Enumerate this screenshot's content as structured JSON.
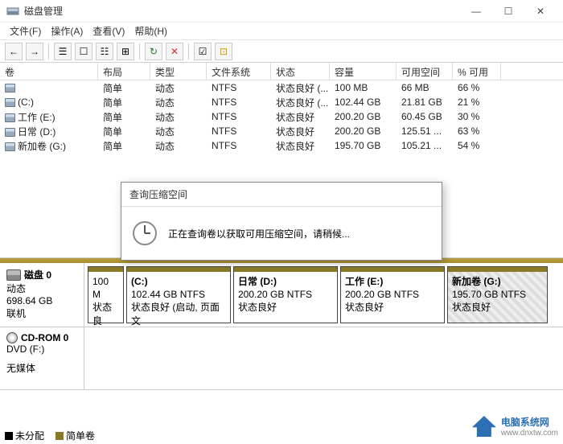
{
  "window": {
    "title": "磁盘管理",
    "min": "—",
    "max": "☐",
    "close": "✕"
  },
  "menu": {
    "file": "文件(F)",
    "action": "操作(A)",
    "view": "查看(V)",
    "help": "帮助(H)"
  },
  "columns": {
    "volume": "卷",
    "layout": "布局",
    "type": "类型",
    "fs": "文件系统",
    "status": "状态",
    "capacity": "容量",
    "free": "可用空间",
    "pct": "% 可用"
  },
  "volumes": [
    {
      "name": "",
      "layout": "简单",
      "type": "动态",
      "fs": "NTFS",
      "status": "状态良好 (...",
      "cap": "100 MB",
      "free": "66 MB",
      "pct": "66 %"
    },
    {
      "name": "(C:)",
      "layout": "简单",
      "type": "动态",
      "fs": "NTFS",
      "status": "状态良好 (...",
      "cap": "102.44 GB",
      "free": "21.81 GB",
      "pct": "21 %"
    },
    {
      "name": "工作 (E:)",
      "layout": "简单",
      "type": "动态",
      "fs": "NTFS",
      "status": "状态良好",
      "cap": "200.20 GB",
      "free": "60.45 GB",
      "pct": "30 %"
    },
    {
      "name": "日常 (D:)",
      "layout": "简单",
      "type": "动态",
      "fs": "NTFS",
      "status": "状态良好",
      "cap": "200.20 GB",
      "free": "125.51 ...",
      "pct": "63 %"
    },
    {
      "name": "新加卷 (G:)",
      "layout": "简单",
      "type": "动态",
      "fs": "NTFS",
      "status": "状态良好",
      "cap": "195.70 GB",
      "free": "105.21 ...",
      "pct": "54 %"
    }
  ],
  "disk0": {
    "label": "磁盘 0",
    "type": "动态",
    "size": "698.64 GB",
    "state": "联机",
    "p0": {
      "size": "100 M",
      "status": "状态良"
    },
    "p1": {
      "label": "(C:)",
      "size": "102.44 GB NTFS",
      "status": "状态良好 (启动, 页面文"
    },
    "p2": {
      "label": "日常  (D:)",
      "size": "200.20 GB NTFS",
      "status": "状态良好"
    },
    "p3": {
      "label": "工作  (E:)",
      "size": "200.20 GB NTFS",
      "status": "状态良好"
    },
    "p4": {
      "label": "新加卷  (G:)",
      "size": "195.70 GB NTFS",
      "status": "状态良好"
    }
  },
  "cdrom": {
    "label": "CD-ROM 0",
    "sub": "DVD (F:)",
    "nomedia": "无媒体"
  },
  "legend": {
    "unalloc": "未分配",
    "simple": "简单卷"
  },
  "dialog": {
    "title": "查询压缩空间",
    "message": "正在查询卷以获取可用压缩空间，请稍候..."
  },
  "watermark": {
    "text": "电脑系统网",
    "url": "www.dnxtw.com"
  }
}
